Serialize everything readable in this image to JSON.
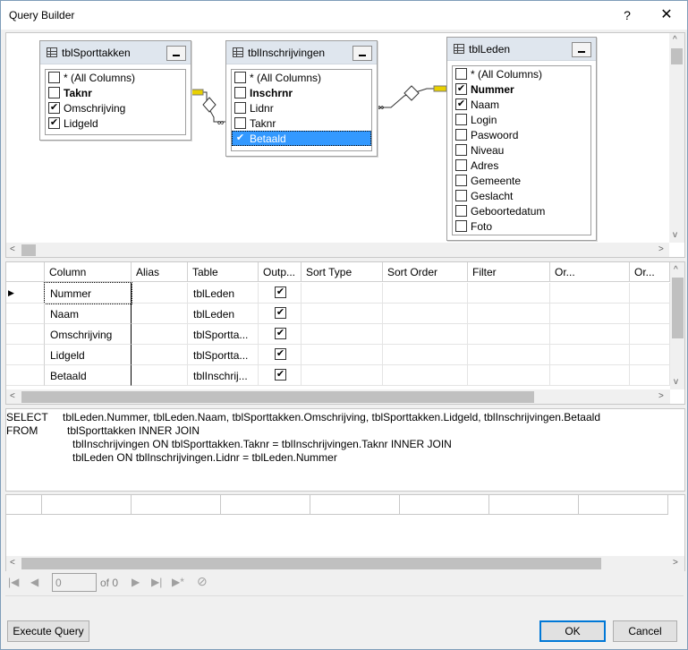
{
  "window": {
    "title": "Query Builder",
    "help": "?",
    "close": "✕"
  },
  "diagram": {
    "tables": [
      {
        "name": "tblSporttakken",
        "columns": [
          {
            "label": "* (All Columns)",
            "checked": false,
            "bold": false
          },
          {
            "label": "Taknr",
            "checked": false,
            "bold": true
          },
          {
            "label": "Omschrijving",
            "checked": true,
            "bold": false
          },
          {
            "label": "Lidgeld",
            "checked": true,
            "bold": false
          }
        ]
      },
      {
        "name": "tblInschrijvingen",
        "columns": [
          {
            "label": "* (All Columns)",
            "checked": false,
            "bold": false
          },
          {
            "label": "Inschrnr",
            "checked": false,
            "bold": true
          },
          {
            "label": "Lidnr",
            "checked": false,
            "bold": false
          },
          {
            "label": "Taknr",
            "checked": false,
            "bold": false
          },
          {
            "label": "Betaald",
            "checked": true,
            "bold": false,
            "selected": true
          }
        ]
      },
      {
        "name": "tblLeden",
        "columns": [
          {
            "label": "* (All Columns)",
            "checked": false,
            "bold": false
          },
          {
            "label": "Nummer",
            "checked": true,
            "bold": true
          },
          {
            "label": "Naam",
            "checked": true,
            "bold": false
          },
          {
            "label": "Login",
            "checked": false,
            "bold": false
          },
          {
            "label": "Paswoord",
            "checked": false,
            "bold": false
          },
          {
            "label": "Niveau",
            "checked": false,
            "bold": false
          },
          {
            "label": "Adres",
            "checked": false,
            "bold": false
          },
          {
            "label": "Gemeente",
            "checked": false,
            "bold": false
          },
          {
            "label": "Geslacht",
            "checked": false,
            "bold": false
          },
          {
            "label": "Geboortedatum",
            "checked": false,
            "bold": false
          },
          {
            "label": "Foto",
            "checked": false,
            "bold": false
          }
        ]
      }
    ]
  },
  "grid": {
    "headers": [
      "Column",
      "Alias",
      "Table",
      "Outp...",
      "Sort Type",
      "Sort Order",
      "Filter",
      "Or...",
      "Or..."
    ],
    "rows": [
      {
        "column": "Nummer",
        "alias": "",
        "table": "tblLeden",
        "output": true
      },
      {
        "column": "Naam",
        "alias": "",
        "table": "tblLeden",
        "output": true
      },
      {
        "column": "Omschrijving",
        "alias": "",
        "table": "tblSportta...",
        "output": true
      },
      {
        "column": "Lidgeld",
        "alias": "",
        "table": "tblSportta...",
        "output": true
      },
      {
        "column": "Betaald",
        "alias": "",
        "table": "tblInschrij...",
        "output": true
      }
    ]
  },
  "sql": {
    "select_kw": "SELECT",
    "select_cols": "tblLeden.Nummer, tblLeden.Naam, tblSporttakken.Omschrijving, tblSporttakken.Lidgeld, tblInschrijvingen.Betaald",
    "from_kw": "FROM",
    "from_1": "tblSporttakken INNER JOIN",
    "from_2": "tblInschrijvingen ON tblSporttakken.Taknr = tblInschrijvingen.Taknr INNER JOIN",
    "from_3": "tblLeden ON tblInschrijvingen.Lidnr = tblLeden.Nummer"
  },
  "navigator": {
    "position": "0",
    "of": "of 0"
  },
  "buttons": {
    "execute": "Execute Query",
    "ok": "OK",
    "cancel": "Cancel"
  },
  "glyphs": {
    "left": "<",
    "right": ">",
    "up": "^",
    "down": "v",
    "check": "✔",
    "row_pointer": "▶",
    "first": "|◀",
    "prev": "◀",
    "next": "▶",
    "last": "▶|",
    "new": "▶*",
    "stop": "⊘"
  }
}
